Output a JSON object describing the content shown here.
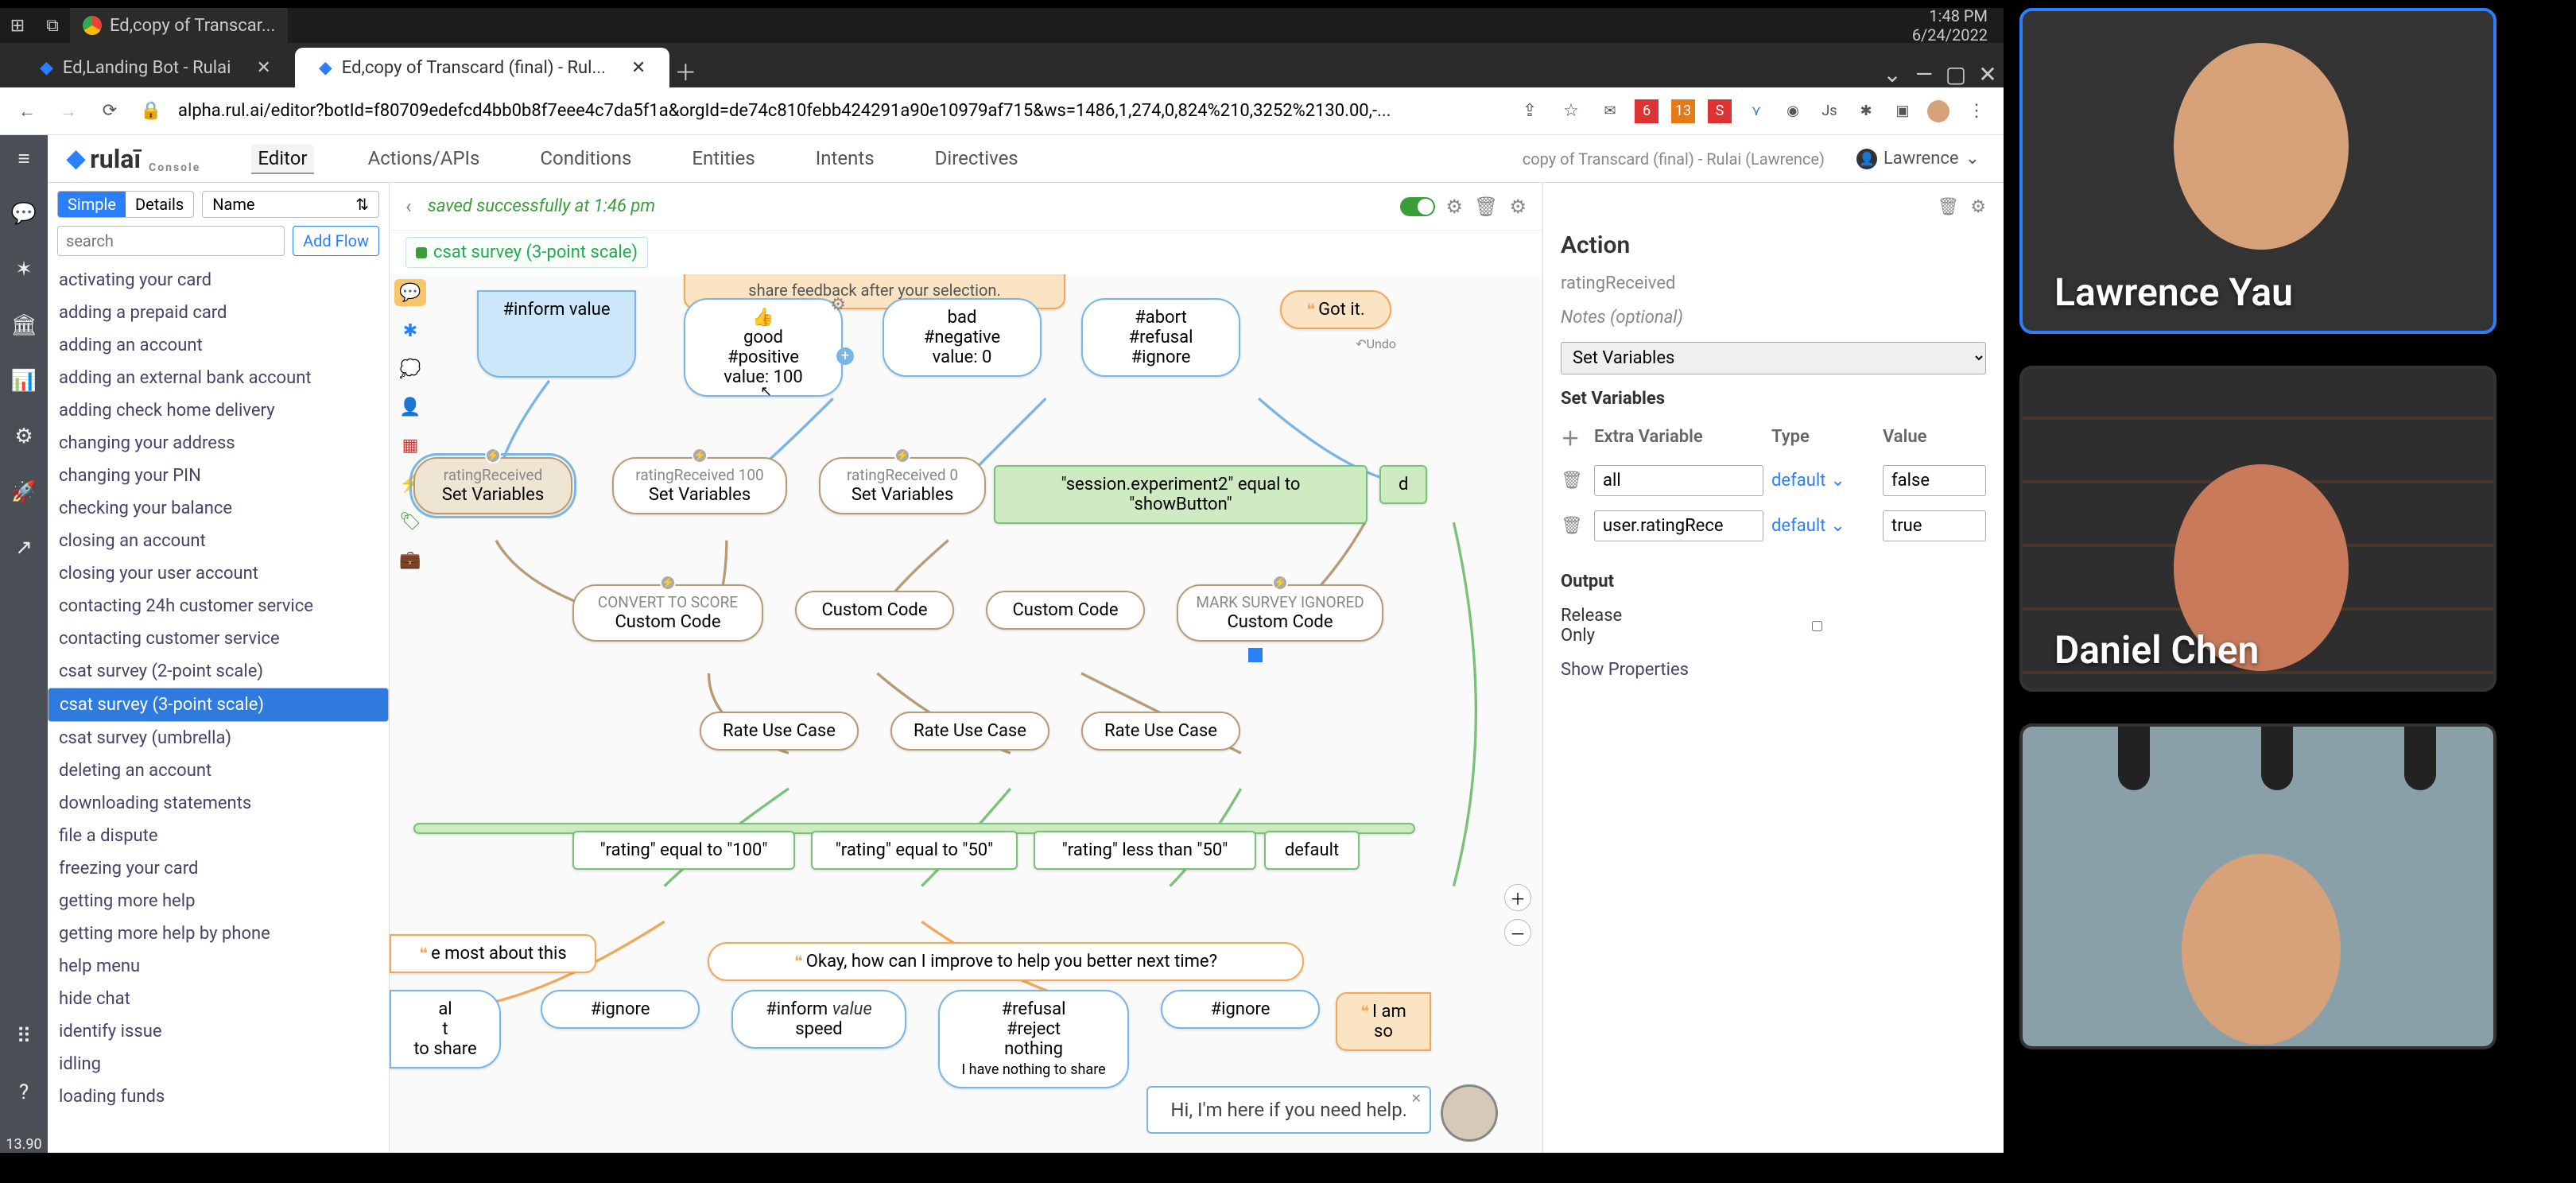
{
  "taskbar": {
    "chrome_tab_title": "Ed,copy of Transcar...",
    "time": "1:48 PM",
    "date": "6/24/2022"
  },
  "browser": {
    "tabs": [
      {
        "title": "Ed,Landing Bot - Rulai",
        "active": false
      },
      {
        "title": "Ed,copy of Transcard (final) - Rul...",
        "active": true
      }
    ],
    "url": "alpha.rul.ai/editor?botId=f80709edefcd4bb0b8f7eee4c7da5f1a&orgId=de74c810febb424291a90e10979af715&ws=1486,1,274,0,824%210,3252%2130.00,-..."
  },
  "app": {
    "logo": "rulaī",
    "logo_sub": "Console",
    "nav": [
      "Editor",
      "Actions/APIs",
      "Conditions",
      "Entities",
      "Intents",
      "Directives"
    ],
    "nav_active": 0,
    "crumb": "copy of Transcard (final) - Rulai (Lawrence)",
    "user": "Lawrence",
    "rail_timer": "13.90"
  },
  "flows": {
    "mode_labels": [
      "Simple",
      "Details"
    ],
    "sort_label": "Name",
    "search_placeholder": "search",
    "addflow": "Add Flow",
    "items": [
      "activating your card",
      "adding a prepaid card",
      "adding an account",
      "adding an external bank account",
      "adding check home delivery",
      "changing your address",
      "changing your PIN",
      "checking your balance",
      "closing an account",
      "closing your user account",
      "contacting 24h customer service",
      "contacting customer service",
      "csat survey (2-point scale)",
      "csat survey (3-point scale)",
      "csat survey (umbrella)",
      "deleting an account",
      "downloading statements",
      "file a dispute",
      "freezing your card",
      "getting more help",
      "getting more help by phone",
      "help menu",
      "hide chat",
      "identify issue",
      "idling",
      "loading funds"
    ],
    "selected_index": 13
  },
  "canvas": {
    "saved_msg": "saved successfully at 1:46 pm",
    "flow_title": "csat survey (3-point scale)",
    "hint_text": "Hi, I'm here if you need help.",
    "banner_trunc": "share feedback after your selection.",
    "got_it": "Got it.",
    "undo": "Undo",
    "nodes": {
      "inform": "#inform value",
      "good": {
        "emoji": "👍",
        "l1": "good",
        "l2": "#positive",
        "l3": "value: 100"
      },
      "bad": {
        "l1": "bad",
        "l2": "#negative",
        "l3": "value: 0"
      },
      "abort": {
        "l1": "#abort",
        "l2": "#refusal",
        "l3": "#ignore"
      },
      "rr": {
        "tag": "ratingReceived",
        "lbl": "Set Variables"
      },
      "rr100": {
        "tag": "ratingReceived 100",
        "lbl": "Set Variables"
      },
      "rr0": {
        "tag": "ratingReceived 0",
        "lbl": "Set Variables"
      },
      "exp": "\"session.experiment2\" equal to \"showButton\"",
      "exp_default": "default",
      "conv": {
        "tag": "CONVERT TO SCORE",
        "lbl": "Custom Code"
      },
      "cc": "Custom Code",
      "msi": {
        "tag": "MARK SURVEY IGNORED",
        "lbl": "Custom Code"
      },
      "rate": "Rate Use Case",
      "r100": "\"rating\" equal to \"100\"",
      "r50": "\"rating\" equal to \"50\"",
      "rlt50": "\"rating\" less than \"50\"",
      "rdef": "default",
      "most": "e most about this",
      "improve": "Okay, how can I improve to help you better next time?",
      "iamso": "I am so",
      "ignore": "#ignore",
      "inform2_a": "#inform",
      "inform2_b": "value",
      "inform2_c": "speed",
      "ref": {
        "l1": "#refusal",
        "l2": "#reject",
        "l3": "nothing",
        "l4": "I have nothing to share"
      },
      "al": "al",
      "t": "t",
      "toshare": "to share"
    }
  },
  "panel": {
    "title": "Action",
    "sub": "ratingReceived",
    "notes_label": "Notes (optional)",
    "type_value": "Set Variables",
    "section": "Set Variables",
    "cols": {
      "extra": "Extra Variable",
      "type": "Type",
      "value": "Value"
    },
    "rows": [
      {
        "name": "all",
        "type": "default",
        "value": "false"
      },
      {
        "name": "user.ratingRece",
        "type": "default",
        "value": "true"
      }
    ],
    "output": "Output",
    "release": "Release Only",
    "props": "Show Properties"
  },
  "video": {
    "p1": "Lawrence Yau",
    "p2": "Daniel Chen"
  }
}
